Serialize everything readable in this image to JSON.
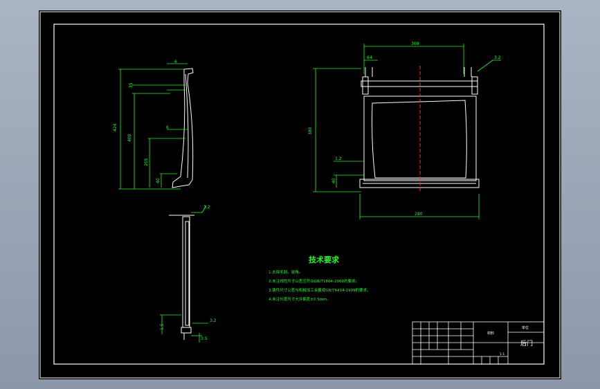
{
  "drawing": {
    "tech_title": "技术要求",
    "tech_notes": [
      "1.去除毛刺、锐角。",
      "2.未注线性尺寸公差应符合GB/T1804-2000的要求。",
      "3.铸件尺寸公差与机械加工余量按GB/T6414-1999的要求。",
      "4.未注长度尺寸允许偏差±0.5mm。"
    ],
    "side_view_dims": [
      "424",
      "400",
      "35",
      "6",
      "6",
      "205",
      "40"
    ],
    "front_view_dims": [
      "300",
      "64",
      "380",
      "1.2",
      "40",
      "280"
    ],
    "roughness": [
      "3.2",
      "3.2",
      "3.2"
    ],
    "bottom_view_dims": [
      "1.5",
      "40",
      "3.5"
    ],
    "title_block": {
      "part_name": "后门",
      "material_label": "材料",
      "company_label": "单位",
      "scale_label": "1:1"
    }
  },
  "colors": {
    "background": "#000000",
    "frame": "#ffffff",
    "dimension": "#2cf02c",
    "centerline": "#ff3030"
  }
}
